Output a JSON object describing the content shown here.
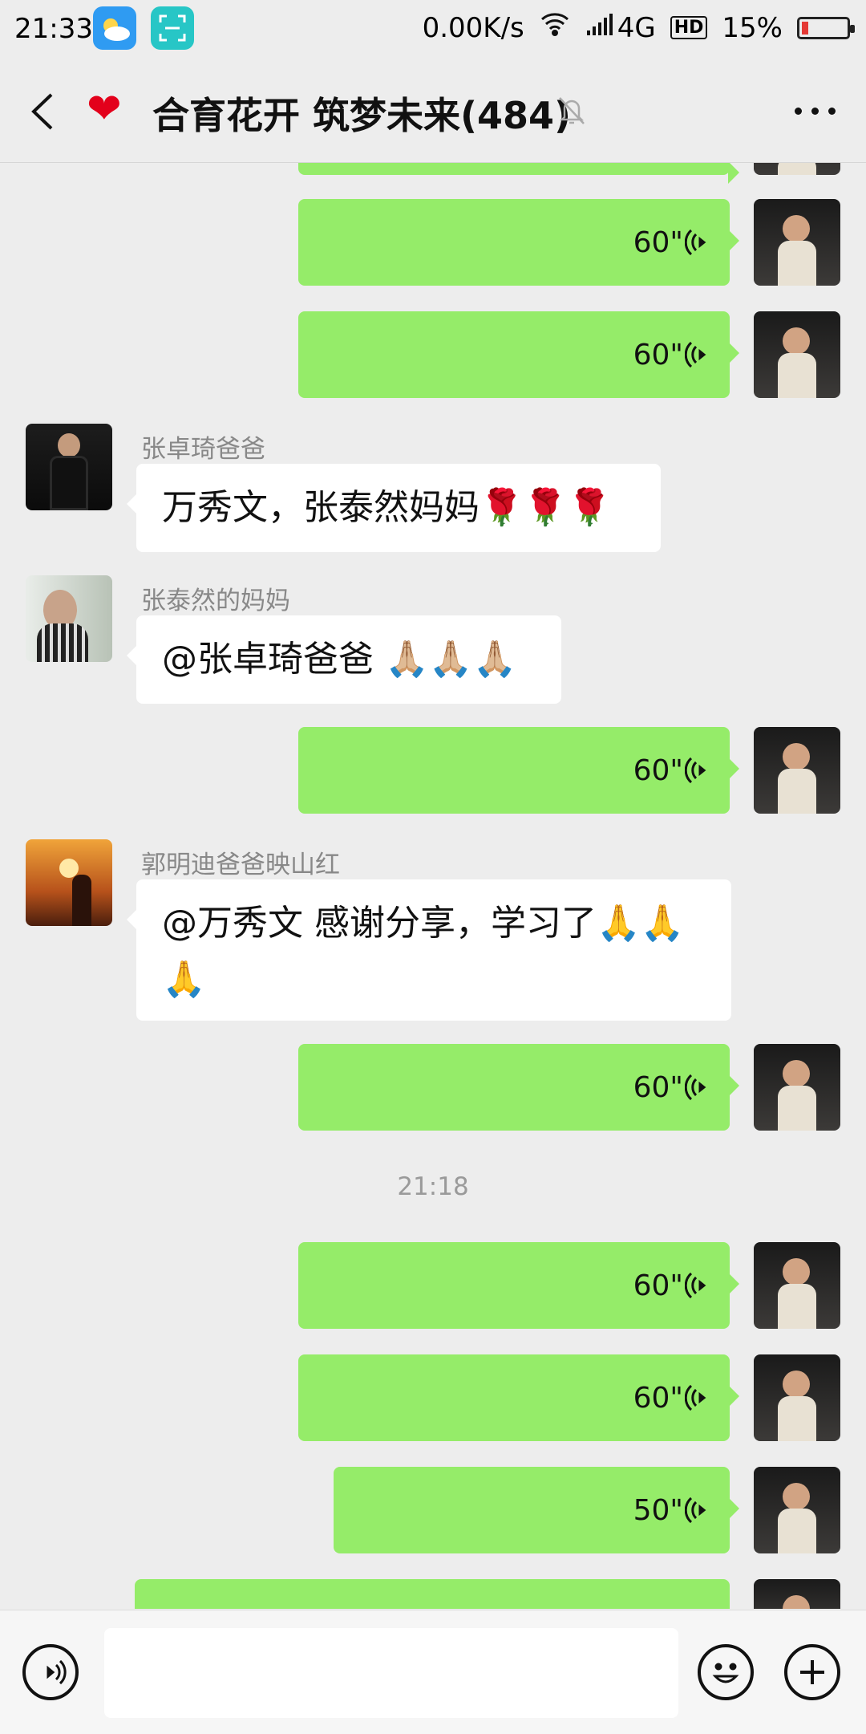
{
  "status_bar": {
    "time": "21:33",
    "net_speed": "0.00K/s",
    "network": "4G",
    "hd": "HD",
    "battery": "15%",
    "icons": [
      "weather-icon",
      "scan-icon",
      "wifi-icon",
      "signal-icon",
      "hd-icon",
      "battery-icon"
    ]
  },
  "header": {
    "heart": "❤",
    "title": "合育花开 筑梦未来(484)",
    "icons": [
      "back-icon",
      "heart-icon",
      "mute-bell-icon",
      "more-icon"
    ]
  },
  "messages": [
    {
      "type": "voice",
      "side": "right",
      "duration": "60\""
    },
    {
      "type": "voice",
      "side": "right",
      "duration": "60\""
    },
    {
      "type": "text",
      "sender": "张卓琦爸爸",
      "text": "万秀文，张泰然妈妈🌹🌹🌹"
    },
    {
      "type": "text",
      "sender": "张泰然的妈妈",
      "text": "@张卓琦爸爸 🙏🏼🙏🏼🙏🏼"
    },
    {
      "type": "voice",
      "side": "right",
      "duration": "60\""
    },
    {
      "type": "text",
      "sender": "郭明迪爸爸映山红",
      "text": "@万秀文  感谢分享，学习了🙏🙏🙏"
    },
    {
      "type": "voice",
      "side": "right",
      "duration": "60\""
    },
    {
      "type": "time",
      "text": "21:18"
    },
    {
      "type": "voice",
      "side": "right",
      "duration": "60\""
    },
    {
      "type": "voice",
      "side": "right",
      "duration": "60\""
    },
    {
      "type": "voice",
      "side": "right",
      "duration": "50\""
    }
  ],
  "input_bar": {
    "icons": [
      "voice-mode-icon",
      "emoji-icon",
      "plus-icon"
    ]
  },
  "colors": {
    "bubble_mine": "#95ec69",
    "bubble_other": "#ffffff",
    "background": "#ededed"
  }
}
